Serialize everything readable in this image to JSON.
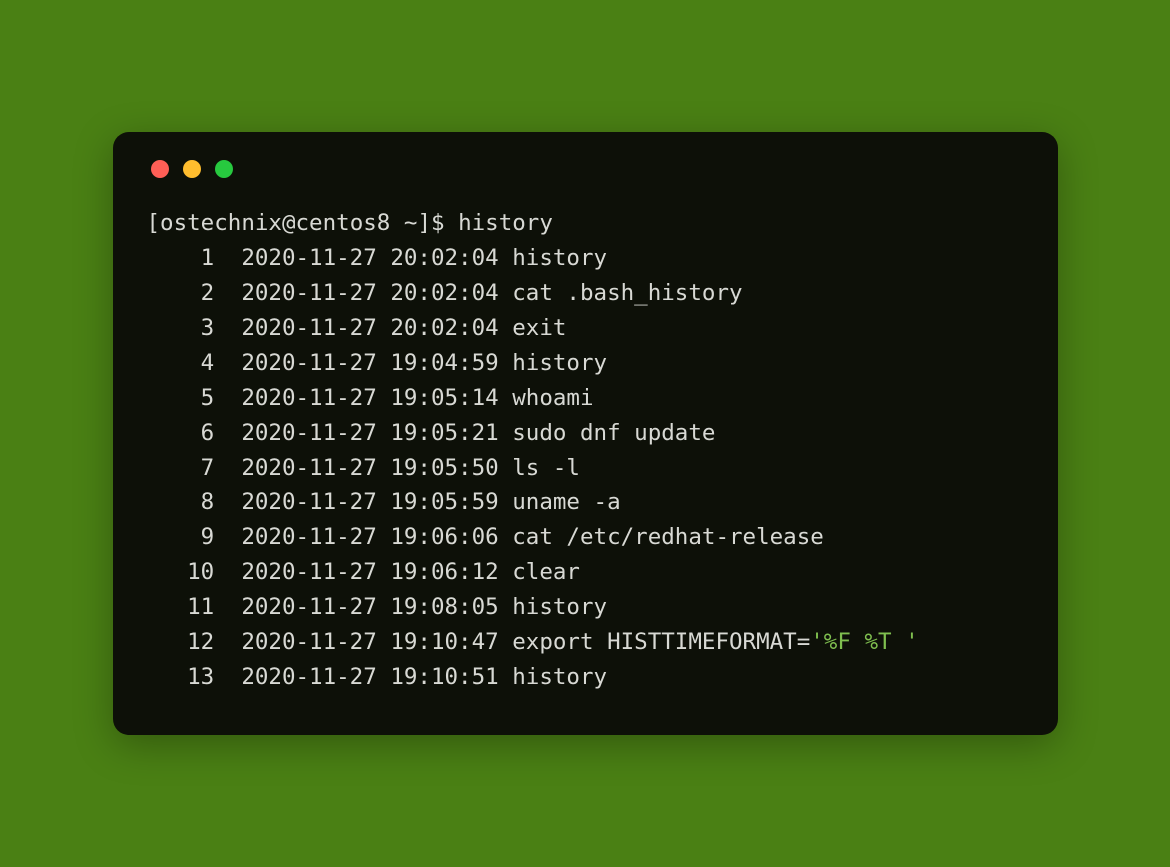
{
  "colors": {
    "page_bg": "#4a8014",
    "terminal_bg": "#0d1008",
    "text": "#d8d9d4",
    "quoted": "#7fbf4f",
    "traffic_red": "#ff5f56",
    "traffic_yellow": "#ffbd2e",
    "traffic_green": "#27c93f"
  },
  "prompt": {
    "open_bracket": "[",
    "user": "ostechnix",
    "at": "@",
    "host": "centos8",
    "space1": " ",
    "path": "~",
    "close_bracket": "]",
    "dollar": "$",
    "space2": " ",
    "command": "history"
  },
  "history": [
    {
      "num": "1",
      "ts": "2020-11-27 20:02:04",
      "cmd": "history",
      "quoted": ""
    },
    {
      "num": "2",
      "ts": "2020-11-27 20:02:04",
      "cmd": "cat .bash_history",
      "quoted": ""
    },
    {
      "num": "3",
      "ts": "2020-11-27 20:02:04",
      "cmd": "exit",
      "quoted": ""
    },
    {
      "num": "4",
      "ts": "2020-11-27 19:04:59",
      "cmd": "history",
      "quoted": ""
    },
    {
      "num": "5",
      "ts": "2020-11-27 19:05:14",
      "cmd": "whoami",
      "quoted": ""
    },
    {
      "num": "6",
      "ts": "2020-11-27 19:05:21",
      "cmd": "sudo dnf update",
      "quoted": ""
    },
    {
      "num": "7",
      "ts": "2020-11-27 19:05:50",
      "cmd": "ls -l",
      "quoted": ""
    },
    {
      "num": "8",
      "ts": "2020-11-27 19:05:59",
      "cmd": "uname -a",
      "quoted": ""
    },
    {
      "num": "9",
      "ts": "2020-11-27 19:06:06",
      "cmd": "cat /etc/redhat-release",
      "quoted": ""
    },
    {
      "num": "10",
      "ts": "2020-11-27 19:06:12",
      "cmd": "clear",
      "quoted": ""
    },
    {
      "num": "11",
      "ts": "2020-11-27 19:08:05",
      "cmd": "history",
      "quoted": ""
    },
    {
      "num": "12",
      "ts": "2020-11-27 19:10:47",
      "cmd": "export HISTTIMEFORMAT=",
      "quoted": "'%F %T '"
    },
    {
      "num": "13",
      "ts": "2020-11-27 19:10:51",
      "cmd": "history",
      "quoted": ""
    }
  ]
}
